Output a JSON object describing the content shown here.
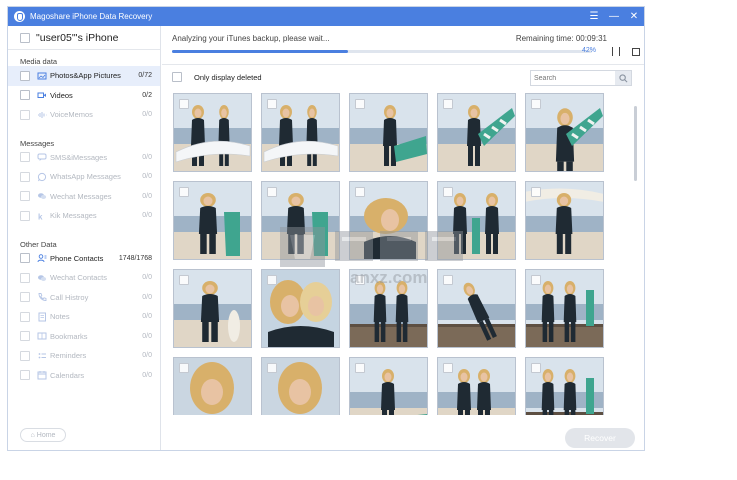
{
  "app": {
    "title": "Magoshare iPhone Data Recovery"
  },
  "device": {
    "name": "\"user05\"'s iPhone"
  },
  "sidebar": {
    "sections": [
      {
        "title": "Media data",
        "items": [
          {
            "label": "Photos&App Pictures",
            "count": "0/72",
            "icon": "photo-icon",
            "active": true,
            "enabled": true
          },
          {
            "label": "Videos",
            "count": "0/2",
            "icon": "video-icon",
            "active": false,
            "enabled": true
          },
          {
            "label": "VoiceMemos",
            "count": "0/0",
            "icon": "voice-memo-icon",
            "active": false,
            "enabled": false
          }
        ]
      },
      {
        "title": "Messages",
        "items": [
          {
            "label": "SMS&iMessages",
            "count": "0/0",
            "icon": "message-icon",
            "active": false,
            "enabled": false
          },
          {
            "label": "WhatsApp Messages",
            "count": "0/0",
            "icon": "whatsapp-icon",
            "active": false,
            "enabled": false
          },
          {
            "label": "Wechat Messages",
            "count": "0/0",
            "icon": "wechat-icon",
            "active": false,
            "enabled": false
          },
          {
            "label": "Kik Messages",
            "count": "0/0",
            "icon": "kik-icon",
            "active": false,
            "enabled": false
          }
        ]
      },
      {
        "title": "Other Data",
        "items": [
          {
            "label": "Phone Contacts",
            "count": "1748/1768",
            "icon": "contacts-icon",
            "active": false,
            "enabled": true
          },
          {
            "label": "Wechat Contacts",
            "count": "0/0",
            "icon": "wechat-icon",
            "active": false,
            "enabled": false
          },
          {
            "label": "Call Histroy",
            "count": "0/0",
            "icon": "phone-icon",
            "active": false,
            "enabled": false
          },
          {
            "label": "Notes",
            "count": "0/0",
            "icon": "notes-icon",
            "active": false,
            "enabled": false
          },
          {
            "label": "Bookmarks",
            "count": "0/0",
            "icon": "bookmark-icon",
            "active": false,
            "enabled": false
          },
          {
            "label": "Reminders",
            "count": "0/0",
            "icon": "reminder-icon",
            "active": false,
            "enabled": false
          },
          {
            "label": "Calendars",
            "count": "0/0",
            "icon": "calendar-icon",
            "active": false,
            "enabled": false
          }
        ]
      }
    ],
    "home_label": "Home"
  },
  "scan": {
    "status": "Analyzing your iTunes backup, please wait...",
    "remaining": "Remaining time: 00:09:31",
    "percent_label": "42%",
    "progress": 0.42
  },
  "filter": {
    "only_deleted_label": "Only display deleted"
  },
  "search": {
    "placeholder": "Search"
  },
  "photos": [
    {
      "scene": "surf-walk"
    },
    {
      "scene": "surf-walk"
    },
    {
      "scene": "surf-crouch"
    },
    {
      "scene": "surf-run"
    },
    {
      "scene": "surf-portrait"
    },
    {
      "scene": "surf-pose"
    },
    {
      "scene": "surf-pose"
    },
    {
      "scene": "hair-wind"
    },
    {
      "scene": "two-surfers"
    },
    {
      "scene": "board-overhead"
    },
    {
      "scene": "surf-hip"
    },
    {
      "scene": "selfie-two"
    },
    {
      "scene": "pier-sitting"
    },
    {
      "scene": "pier-jump"
    },
    {
      "scene": "pier-two"
    },
    {
      "scene": "closeup"
    },
    {
      "scene": "closeup"
    },
    {
      "scene": "beach-sit"
    },
    {
      "scene": "two-boards"
    },
    {
      "scene": "pier-two"
    }
  ],
  "recover_label": "Recover",
  "watermark": {
    "text": "anxz.com"
  },
  "colors": {
    "accent": "#4a7fe0",
    "sky": "#d9e3ec",
    "sea": "#9fb3c6",
    "sand": "#e0d6c6",
    "wetsuit": "#1f2a33",
    "board_teal": "#3fa58f"
  }
}
